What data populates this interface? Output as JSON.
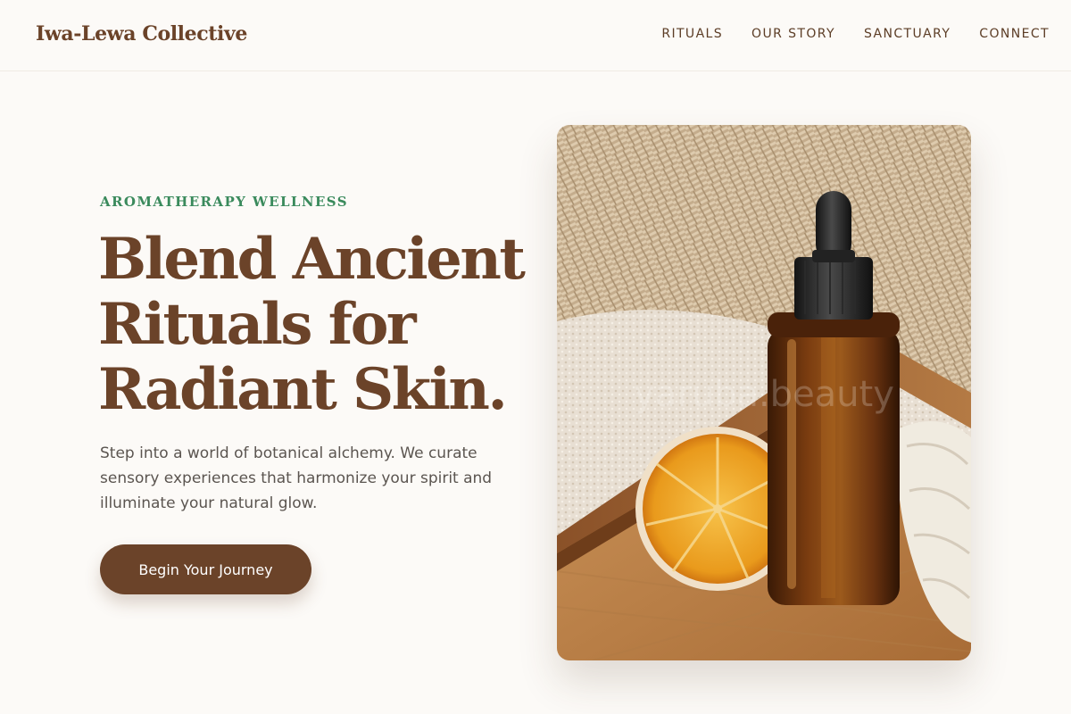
{
  "brand": {
    "name": "Iwa-Lewa Collective"
  },
  "nav": {
    "items": [
      {
        "label": "RITUALS"
      },
      {
        "label": "OUR STORY"
      },
      {
        "label": "SANCTUARY"
      },
      {
        "label": "CONNECT"
      }
    ]
  },
  "hero": {
    "eyebrow": "AROMATHERAPY WELLNESS",
    "headline_lines": [
      "Blend Ancient",
      "Rituals for",
      "Radiant Skin."
    ],
    "lead": "Step into a world of botanical alchemy. We curate sensory experiences that harmonize your spirit and illuminate your natural glow.",
    "cta_label": "Begin Your Journey",
    "image_watermark": "yaruba.beauty"
  },
  "colors": {
    "brand_brown": "#6b4329",
    "accent_green": "#3a8a5c",
    "background": "#fcfaf7",
    "body_text": "#5b5550"
  }
}
